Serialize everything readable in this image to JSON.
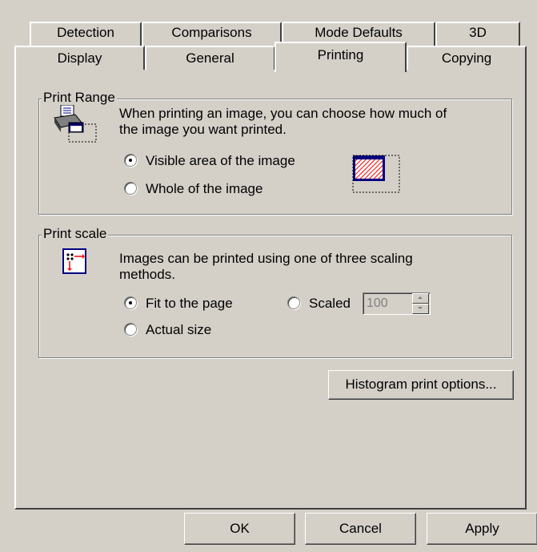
{
  "tabs_back": [
    "Detection",
    "Comparisons",
    "Mode Defaults",
    "3D"
  ],
  "tabs_front": [
    "Display",
    "General",
    "Printing",
    "Copying"
  ],
  "active_tab": "Printing",
  "print_range": {
    "title": "Print Range",
    "description_line1": "When printing an image, you can choose how much of",
    "description_line2": "the image you want printed.",
    "option_visible": "Visible area of the image",
    "option_whole": "Whole of the image",
    "selected": "Visible area of the image"
  },
  "print_scale": {
    "title": "Print scale",
    "description_line1": "Images can be printed using one of three scaling",
    "description_line2": "methods.",
    "option_fit": "Fit to the page",
    "option_scaled": "Scaled",
    "option_actual": "Actual size",
    "scaled_value": "100",
    "selected": "Fit to the page"
  },
  "histogram_button": "Histogram print options...",
  "buttons": {
    "ok": "OK",
    "cancel": "Cancel",
    "apply": "Apply"
  },
  "colors": {
    "face": "#d4d0c8",
    "highlight": "#ffffff",
    "shadow": "#808080",
    "dark_shadow": "#404040",
    "icon_blue": "#000080",
    "icon_red": "#ff0000"
  }
}
